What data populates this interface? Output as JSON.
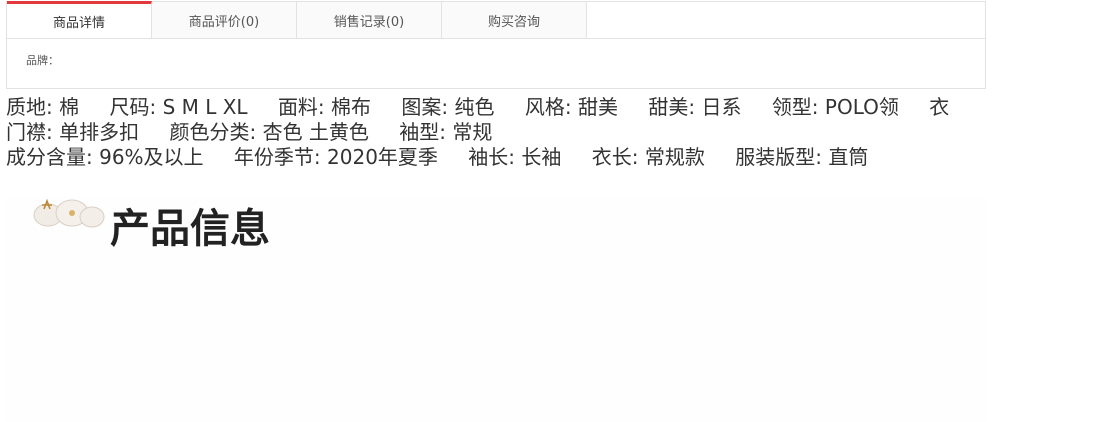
{
  "tabs": [
    {
      "label": "商品详情",
      "active": true
    },
    {
      "label": "商品评价(0)",
      "active": false
    },
    {
      "label": "销售记录(0)",
      "active": false
    },
    {
      "label": "购买咨询",
      "active": false
    }
  ],
  "brand_label": "品牌：",
  "attributes": [
    "质地: 棉",
    "尺码: S M L XL",
    "面料: 棉布",
    "图案: 纯色",
    "风格: 甜美",
    "甜美: 日系",
    "领型: POLO领",
    "衣门襟: 单排多扣",
    "颜色分类: 杏色 土黄色",
    "袖型: 常规",
    "成分含量: 96%及以上",
    "年份季节: 2020年夏季",
    "袖长: 长袖",
    "衣长: 常规款",
    "服装版型: 直筒"
  ],
  "section_heading": "产品信息",
  "colors": {
    "accent": "#e4393c",
    "border": "#e2e2e2"
  }
}
